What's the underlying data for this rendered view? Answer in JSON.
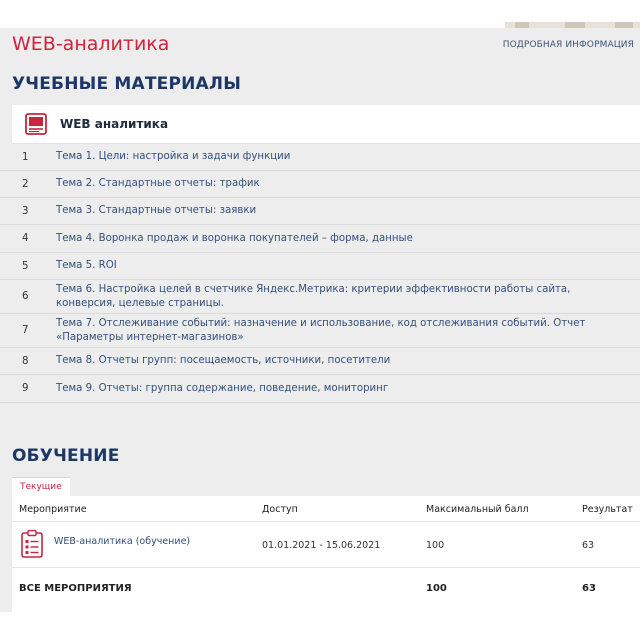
{
  "header": {
    "title": "WEB-аналитика",
    "more_link": "ПОДРОБНАЯ ИНФОРМАЦИЯ"
  },
  "materials": {
    "section_title": "УЧЕБНЫЕ МАТЕРИАЛЫ",
    "card_title": "WEB аналитика",
    "card_icon": "book-icon",
    "topics": [
      {
        "num": "1",
        "label": "Тема 1. Цели: настройка и задачи функции"
      },
      {
        "num": "2",
        "label": "Тема 2. Стандартные отчеты: трафик"
      },
      {
        "num": "3",
        "label": "Тема 3. Стандартные отчеты: заявки"
      },
      {
        "num": "4",
        "label": "Тема 4. Воронка продаж и воронка покупателей – форма, данные"
      },
      {
        "num": "5",
        "label": "Тема 5. ROI"
      },
      {
        "num": "6",
        "label": "Тема 6. Настройка целей в счетчике Яндекс.Метрика: критерии эффективности работы сайта, конверсия, целевые страницы."
      },
      {
        "num": "7",
        "label": "Тема 7. Отслеживание событий: назначение и использование, код отслеживания событий. Отчет «Параметры интернет-магазинов»"
      },
      {
        "num": "8",
        "label": "Тема 8. Отчеты групп: посещаемость, источники, посетители"
      },
      {
        "num": "9",
        "label": "Тема 9. Отчеты: группа содержание, поведение, мониторинг"
      }
    ]
  },
  "training": {
    "section_title": "ОБУЧЕНИЕ",
    "tab_current": "Текущие",
    "columns": {
      "event": "Мероприятие",
      "access": "Доступ",
      "max_score": "Максимальный балл",
      "result": "Результат"
    },
    "rows": [
      {
        "icon": "checklist-icon",
        "event": "WEB-аналитика (обучение)",
        "access": "01.01.2021 - 15.06.2021",
        "max_score": "100",
        "result": "63"
      }
    ],
    "total": {
      "label": "ВСЕ МЕРОПРИЯТИЯ",
      "max_score": "100",
      "result": "63"
    }
  },
  "colors": {
    "brand_red": "#d2233c",
    "heading_navy": "#1c3766",
    "link_blue": "#33507a",
    "background": "#ededed"
  }
}
